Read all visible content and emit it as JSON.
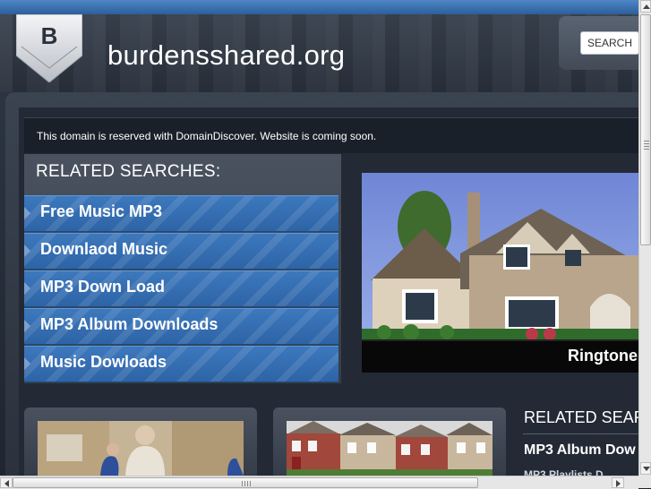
{
  "header": {
    "logo_letter": "B",
    "site_name": "burdensshared.org",
    "search_label": "SEARCH"
  },
  "notice": {
    "text": "This domain is reserved with DomainDiscover. Website is coming soon."
  },
  "related_searches": {
    "title": "RELATED SEARCHES:",
    "items": [
      {
        "label": "Free Music MP3"
      },
      {
        "label": "Downlaod Music"
      },
      {
        "label": "MP3 Down Load"
      },
      {
        "label": "MP3 Album Downloads"
      },
      {
        "label": "Music Dowloads"
      }
    ]
  },
  "feature": {
    "caption": "Ringtone"
  },
  "related_right": {
    "title": "RELATED SEAR",
    "item1": "MP3 Album Dow",
    "item2": "MP3 Playlists D"
  },
  "colors": {
    "accent_blue": "#3d78bd",
    "background": "#1c2330",
    "topbar": "#4f86c6"
  },
  "icons": [
    "shield-logo-icon",
    "arrow-right-icon",
    "scroll-up-icon",
    "scroll-down-icon",
    "scroll-left-icon",
    "scroll-right-icon"
  ]
}
